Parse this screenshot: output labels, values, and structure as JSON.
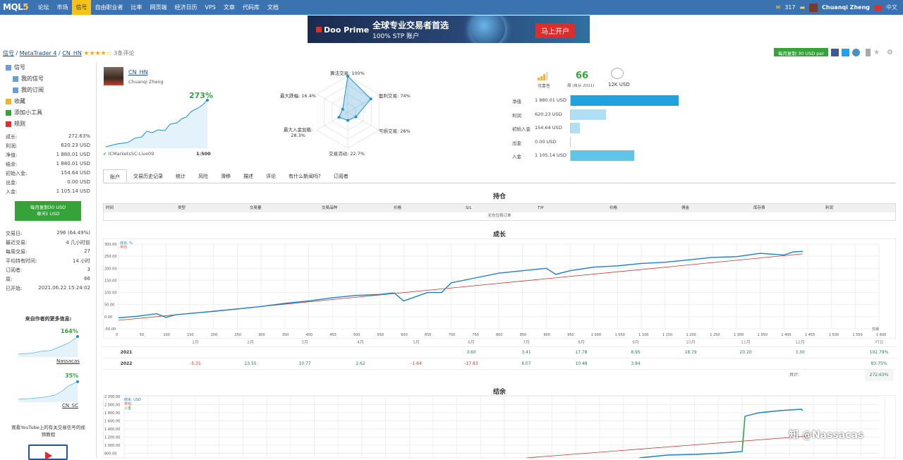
{
  "topbar": {
    "logo_a": "MQL",
    "logo_b": "5",
    "nav": [
      "论坛",
      "市场",
      "信号",
      "自由职业者",
      "比率",
      "网页端",
      "经济日历",
      "VPS",
      "文章",
      "代码库",
      "文档"
    ],
    "active_nav": "信号",
    "count": "317",
    "user": "Chuanqi Zheng",
    "lang": "中文"
  },
  "banner": {
    "brand": "Doo Prime",
    "title": "全球专业交易者首选",
    "subtitle": "100% STP 账户",
    "cta": "马上开户"
  },
  "breadcrumb": {
    "root": "信号",
    "platform": "MetaTrader 4",
    "name": "CN_HN",
    "stars": "★★★★☆",
    "reviews": "3条评论"
  },
  "actions": {
    "subscribe": "每月复制 30 USD per"
  },
  "sidebar": {
    "menu": [
      "信号",
      "我的信号",
      "我的订阅",
      "收藏",
      "添加小工具",
      "规则"
    ],
    "stats1": [
      {
        "k": "成长:",
        "v": "272.63%"
      },
      {
        "k": "利润:",
        "v": "620.23 USD"
      },
      {
        "k": "净值:",
        "v": "1 880.01 USD"
      },
      {
        "k": "结余:",
        "v": "1 880.01 USD"
      },
      {
        "k": "初始入金:",
        "v": "154.64 USD"
      },
      {
        "k": "出金:",
        "v": "0.00 USD"
      },
      {
        "k": "入金:",
        "v": "1 105.14 USD"
      }
    ],
    "button_line1": "每月复制30 USD",
    "button_line2": "每天1 USD",
    "stats2": [
      {
        "k": "交易日:",
        "v": "296 (64.49%)"
      },
      {
        "k": "最近交易:",
        "v": "4 几小时前"
      },
      {
        "k": "每周交易:",
        "v": "27"
      },
      {
        "k": "平均持有时间:",
        "v": "14 小时"
      },
      {
        "k": "订阅者:",
        "v": "3"
      },
      {
        "k": "周:",
        "v": "66"
      },
      {
        "k": "已开始:",
        "v": "2021.06.22 15:24:02"
      }
    ],
    "more_title": "来自作者的更多信息:",
    "more": [
      {
        "pct": "164%",
        "name": "Nassacas"
      },
      {
        "pct": "35%",
        "name": "CN_SC"
      }
    ],
    "youtube_text_1": "观看YouTube上的有关交易信号的视",
    "youtube_text_2": "频教程"
  },
  "profile": {
    "name": "CN_HN",
    "author": "Chuanqi Zheng",
    "growth": "273%",
    "broker": "ICMarketsSC-Live09",
    "leverage": "1:500"
  },
  "radar": {
    "axes": [
      {
        "label": "算法交易: 100%",
        "value": 1.0
      },
      {
        "label": "盈利交易: 74%",
        "value": 0.74
      },
      {
        "label": "亏损交易: 26%",
        "value": 0.26
      },
      {
        "label": "交易活动: 22.7%",
        "value": 0.227
      },
      {
        "label": "最大入金加载:",
        "label2": "28.3%",
        "value": 0.283
      },
      {
        "label": "最大跌幅: 16.4%",
        "value": 0.164
      }
    ],
    "rings": [
      "100+%",
      "50%"
    ]
  },
  "summary": {
    "reliability": "可靠性",
    "weeks": "66",
    "weeks_label": "周 (自从 2021)",
    "subs": "12K USD"
  },
  "bars": [
    {
      "label": "净值",
      "value": "1 880.01 USD",
      "num": 1880.01
    },
    {
      "label": "利润",
      "value": "620.23 USD",
      "num": 620.23
    },
    {
      "label": "初始入金",
      "value": "154.64 USD",
      "num": 154.64
    },
    {
      "label": "出金",
      "value": "0.00 USD",
      "num": 0
    },
    {
      "label": "入金",
      "value": "1 105.14 USD",
      "num": 1105.14
    }
  ],
  "tabs": [
    "账户",
    "交易历史记录",
    "统计",
    "风险",
    "滑移",
    "描述",
    "评论",
    "有什么新闻吗?",
    "订阅者"
  ],
  "positions": {
    "title": "持仓",
    "cols": [
      "时间",
      "类型",
      "交易量",
      "交易品种",
      "价格",
      "S/L",
      "T/P",
      "价格",
      "佣金",
      "库存费",
      "利润"
    ],
    "empty": "无仓位和订单"
  },
  "growth_title": "成长",
  "balance_title": "结余",
  "chart_data": [
    {
      "type": "line",
      "title": "成长",
      "legend": [
        "成长, %",
        "平均"
      ],
      "ylim": [
        -50,
        300
      ],
      "yticks": [
        "300.00",
        "250.00",
        "200.00",
        "150.00",
        "100.00",
        "50.00",
        "0.00",
        "-50.00"
      ],
      "xticks": [
        "0",
        "50",
        "100",
        "150",
        "200",
        "250",
        "300",
        "350",
        "400",
        "450",
        "500",
        "550",
        "600",
        "650",
        "700",
        "750",
        "800",
        "850",
        "900",
        "950",
        "1 000",
        "1 050",
        "1 100",
        "1 150",
        "1 200",
        "1 250",
        "1 300",
        "1 350",
        "1 400",
        "1 450",
        "1 500",
        "1 550",
        "1 600"
      ],
      "xlabel": "交易",
      "series": [
        {
          "name": "成长, %",
          "x": [
            0,
            40,
            80,
            100,
            120,
            160,
            200,
            250,
            300,
            350,
            400,
            450,
            500,
            550,
            580,
            600,
            650,
            680,
            700,
            750,
            800,
            850,
            900,
            920,
            950,
            1000,
            1050,
            1100,
            1150,
            1200,
            1250,
            1300,
            1350,
            1400,
            1420,
            1440
          ],
          "y": [
            -5,
            2,
            12,
            -3,
            8,
            15,
            22,
            32,
            42,
            55,
            65,
            78,
            88,
            92,
            98,
            65,
            100,
            100,
            140,
            160,
            180,
            190,
            200,
            175,
            190,
            205,
            210,
            220,
            225,
            235,
            245,
            248,
            262,
            255,
            268,
            270
          ]
        },
        {
          "name": "平均",
          "x": [
            0,
            1440
          ],
          "y": [
            -15,
            260
          ]
        }
      ]
    },
    {
      "type": "table",
      "columns": [
        "1月",
        "2月",
        "3月",
        "4月",
        "5月",
        "6月",
        "7月",
        "8月",
        "9月",
        "10月",
        "11月",
        "12月",
        "YTD"
      ],
      "rows": [
        {
          "year": "2021",
          "values": [
            "",
            "",
            "",
            "",
            "",
            "3.60",
            "3.41",
            "17.78",
            "8.95",
            "18.79",
            "20.20",
            "3.30",
            "102.79%"
          ]
        },
        {
          "year": "2022",
          "values": [
            "-5.31",
            "23.55",
            "10.77",
            "2.62",
            "-1.64",
            "-17.83",
            "6.07",
            "10.48",
            "3.84",
            "",
            "",
            "",
            "83.75%"
          ]
        }
      ],
      "total_label": "共计:",
      "total": "272.63%"
    },
    {
      "type": "line",
      "title": "结余",
      "legend": [
        "结余, USD",
        "平均",
        "入金"
      ],
      "ylim": [
        800,
        2200
      ],
      "yticks": [
        "2 200.00",
        "2 000.00",
        "1 800.00",
        "1 600.00",
        "1 400.00",
        "1 200.00",
        "1 000.00",
        "800.00"
      ]
    }
  ],
  "colors": {
    "accent": "#1e90d0",
    "green": "#35a33a",
    "nav": "#3b72b0",
    "avg": "#c0392b"
  }
}
